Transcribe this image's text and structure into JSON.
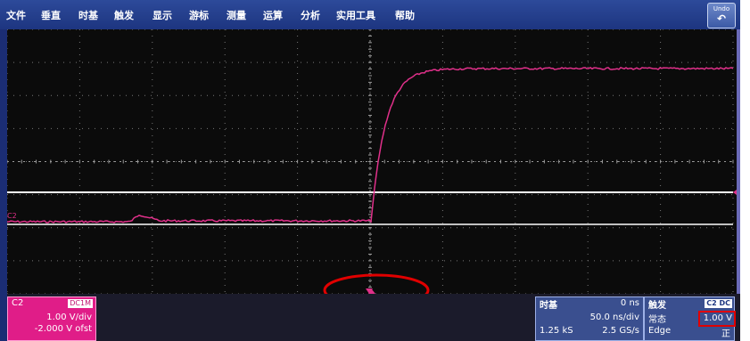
{
  "menubar": {
    "items": [
      "文件",
      "垂直",
      "时基",
      "触发",
      "显示",
      "游标",
      "测量",
      "运算",
      "分析",
      "实用工具",
      "帮助"
    ],
    "undo_label": "Undo"
  },
  "scope": {
    "channel_marker": "C2",
    "trace_color": "#e0308a",
    "trigger_circle_color": "#e00000"
  },
  "channel": {
    "name": "C2",
    "coupling": "DC1M",
    "vdiv": "1.00 V/div",
    "offset": "-2.000 V ofst",
    "color": "#e01d88"
  },
  "timebase": {
    "title": "时基",
    "delay": "0 ns",
    "time_per_div": "50.0 ns/div",
    "points": "1.25 kS",
    "sample_rate": "2.5 GS/s"
  },
  "trigger": {
    "title": "触发",
    "source_badge": "C2 DC",
    "mode": "常态",
    "level": "1.00 V",
    "type": "Edge",
    "slope": "正"
  }
}
